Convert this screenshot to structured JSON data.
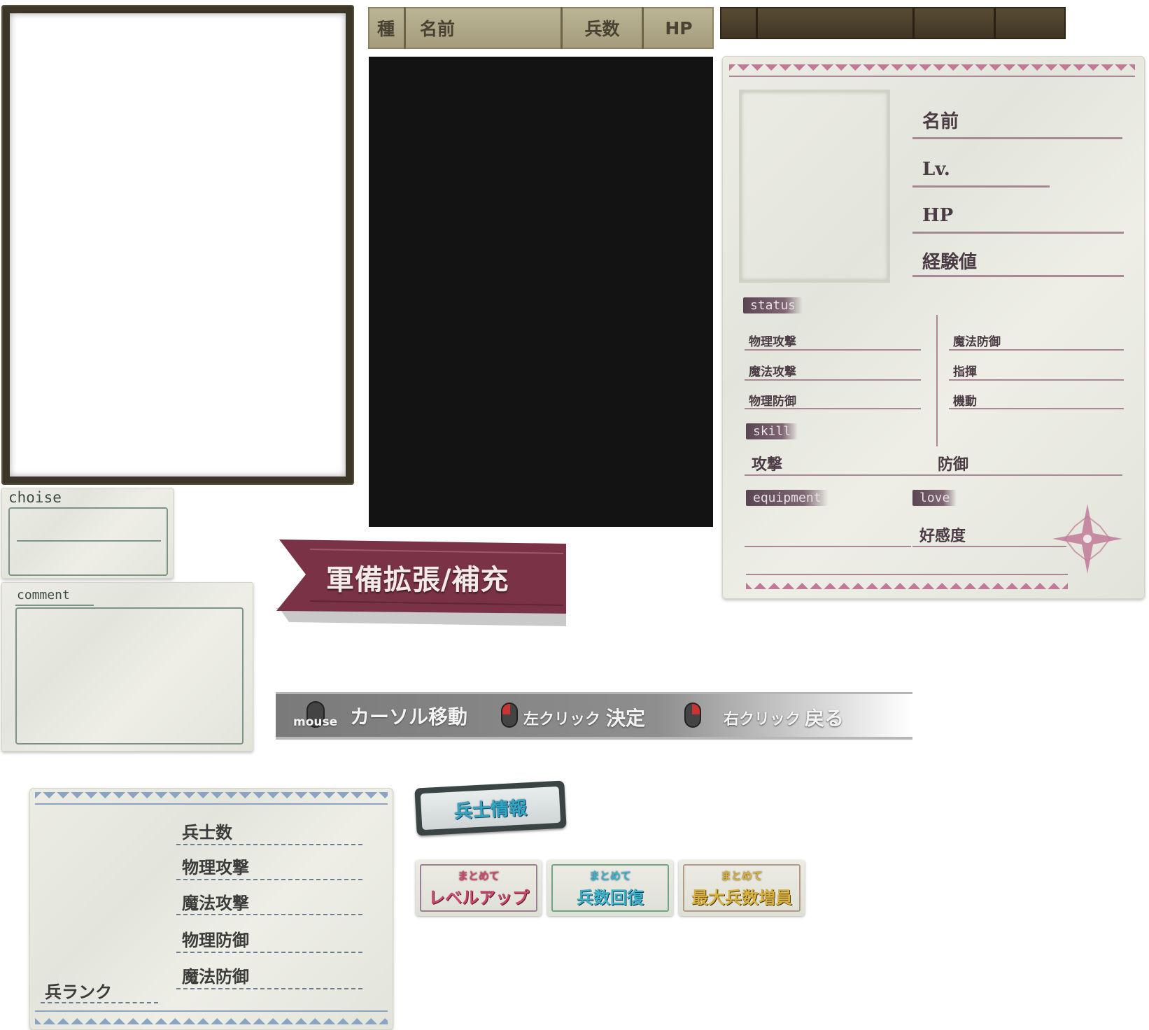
{
  "list_header": {
    "col_type": "種",
    "col_name": "名前",
    "col_troops": "兵数",
    "col_hp": "HP"
  },
  "status_card": {
    "name_label": "名前",
    "level_label": "Lv.",
    "hp_label": "HP",
    "exp_label": "経験値",
    "status_tag": "status",
    "stats_left": [
      "物理攻撃",
      "魔法攻撃",
      "物理防御"
    ],
    "stats_right": [
      "魔法防御",
      "指揮",
      "機動"
    ],
    "skill_tag": "skill",
    "skill_attack": "攻撃",
    "skill_defense": "防御",
    "equipment_tag": "equipment",
    "love_tag": "love",
    "affection_label": "好感度"
  },
  "choise_panel": {
    "label": "choise"
  },
  "comment_panel": {
    "label": "comment"
  },
  "ribbon": {
    "title": "軍備拡張/補充"
  },
  "controls": {
    "mouse_label": "mouse",
    "move_label": "カーソル移動",
    "left_click": "左クリック",
    "confirm": "決定",
    "right_click": "右クリック",
    "back": "戻る"
  },
  "soldier_card": {
    "stats": [
      "兵士数",
      "物理攻撃",
      "魔法攻撃",
      "物理防御",
      "魔法防御"
    ],
    "rank_label": "兵ランク"
  },
  "soldier_info_button": {
    "label": "兵士情報"
  },
  "action_buttons": [
    {
      "small": "まとめて",
      "big": "レベルアップ",
      "color": "#c94a6a",
      "frame": "#9a7f94"
    },
    {
      "small": "まとめて",
      "big": "兵数回復",
      "color": "#3bb3c8",
      "frame": "#6fa584"
    },
    {
      "small": "まとめて",
      "big": "最大兵数増員",
      "color": "#d8b13c",
      "frame": "#b29a86"
    }
  ],
  "colors": {
    "ribbon": "#7a3346",
    "accent_pink": "#c07a98",
    "accent_blue": "#8ba4c2"
  }
}
